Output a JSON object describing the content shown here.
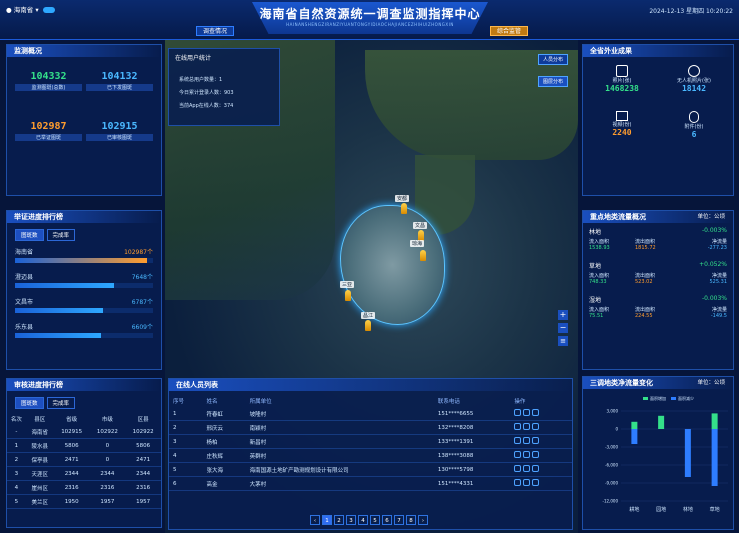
{
  "header": {
    "region": "海南省",
    "title": "海南省自然资源统一调查监测指挥中心",
    "subtitle": "HAINANSHENGZIRANZIYUANTONGYIDIAOCHAJIANCEZHIHUIZHONGXIN",
    "btn_left": "调查情况",
    "btn_right": "综合监管",
    "datetime": "2024-12-13 星期四 10:20:22"
  },
  "map": {
    "btn_distribution": "图层分布",
    "btn_layer": "人员分布",
    "pins": [
      "安都",
      "文昌",
      "琼海",
      "三亚",
      "昌江",
      "东方"
    ],
    "region_label": "海南"
  },
  "monitor": {
    "title": "监测概况",
    "items": [
      {
        "value": "104332",
        "label": "监测图斑(总数)"
      },
      {
        "value": "104132",
        "label": "已下发图斑"
      },
      {
        "value": "102987",
        "label": "已举证图斑"
      },
      {
        "value": "102915",
        "label": "已审核图斑"
      }
    ]
  },
  "evidence": {
    "title": "举证进度排行榜",
    "tabs": [
      "图斑数",
      "完成率"
    ],
    "items": [
      {
        "name": "海南省",
        "value": "102987个",
        "pct": 0.96
      },
      {
        "name": "澄迈县",
        "value": "7648个",
        "pct": 0.72
      },
      {
        "name": "文昌市",
        "value": "6787个",
        "pct": 0.64
      },
      {
        "name": "乐东县",
        "value": "6609个",
        "pct": 0.62
      }
    ]
  },
  "review": {
    "title": "审核进度排行榜",
    "tabs": [
      "图斑数",
      "完成率"
    ],
    "cols": [
      "名次",
      "县区",
      "省级",
      "市级",
      "区县"
    ],
    "rows": [
      [
        "-",
        "海南省",
        "102915",
        "102922",
        "102922"
      ],
      [
        "1",
        "陵水县",
        "5806",
        "0",
        "5806"
      ],
      [
        "2",
        "保亭县",
        "2471",
        "0",
        "2471"
      ],
      [
        "3",
        "天涯区",
        "2344",
        "2344",
        "2344"
      ],
      [
        "4",
        "崖州区",
        "2316",
        "2316",
        "2316"
      ],
      [
        "5",
        "美兰区",
        "1950",
        "1957",
        "1957"
      ]
    ]
  },
  "online": {
    "title": "在线用户统计",
    "items": [
      "系统总用户数量：1",
      "今日累计登录人数：903",
      "当前App在线人数：374"
    ]
  },
  "people": {
    "title": "在线人员列表",
    "cols": [
      "序号",
      "姓名",
      "所属单位",
      "联系电话",
      "操作"
    ],
    "rows": [
      [
        "1",
        "符春虹",
        "坡隆村",
        "151****6655"
      ],
      [
        "2",
        "邢庆云",
        "南颖村",
        "132****8208"
      ],
      [
        "3",
        "杨柏",
        "新昌村",
        "133****1391"
      ],
      [
        "4",
        "庄秋辉",
        "英群村",
        "138****3088"
      ],
      [
        "5",
        "张大海",
        "海南国源土地矿产勘测规划设计有限公司",
        "130****5798"
      ],
      [
        "6",
        "高金",
        "大茅村",
        "151****4331"
      ]
    ],
    "pages": [
      "1",
      "2",
      "3",
      "4",
      "5",
      "6",
      "7",
      "8"
    ]
  },
  "field": {
    "title": "全省外业成果",
    "items": [
      {
        "label": "照片(张)",
        "value": "1468238"
      },
      {
        "label": "无人机照片(张)",
        "value": "18142"
      },
      {
        "label": "视频(份)",
        "value": "2240"
      },
      {
        "label": "附件(份)",
        "value": "6"
      }
    ]
  },
  "flow": {
    "title": "重点地类流量概况",
    "unit": "单位：公顷",
    "rows": [
      {
        "name": "林地",
        "change": "-0.003%",
        "cols": [
          "流入面积",
          "流出面积",
          "净流量"
        ],
        "vals": [
          "1538.93",
          "1815.72",
          "-277.23"
        ]
      },
      {
        "name": "草地",
        "change": "+0.052%",
        "cols": [
          "流入面积",
          "流出面积",
          "净流量"
        ],
        "vals": [
          "748.33",
          "523.02",
          "525.31"
        ]
      },
      {
        "name": "湿地",
        "change": "-0.003%",
        "cols": [
          "流入面积",
          "流出面积",
          "净流量"
        ],
        "vals": [
          "75.51",
          "224.55",
          "-149.5"
        ]
      }
    ]
  },
  "net": {
    "title": "三调地类净流量变化",
    "unit": "单位：公顷",
    "legend": [
      "面积增加",
      "面积减少"
    ],
    "chart_data": {
      "type": "bar",
      "categories": [
        "耕地",
        "园地",
        "林地",
        "草地"
      ],
      "yticks": [
        "3,000",
        "0",
        "-3,000",
        "-6,000",
        "-9,000",
        "-12,000"
      ],
      "ylim": [
        -12000,
        3000
      ],
      "series": [
        {
          "name": "面积增加",
          "values": [
            1200,
            2200,
            0,
            2600
          ]
        },
        {
          "name": "面积减少",
          "values": [
            -2500,
            0,
            -8000,
            -9500
          ]
        }
      ]
    }
  },
  "colors": {
    "accent": "#2ea8ff",
    "orange": "#ff9d2e",
    "green": "#34e08a"
  }
}
